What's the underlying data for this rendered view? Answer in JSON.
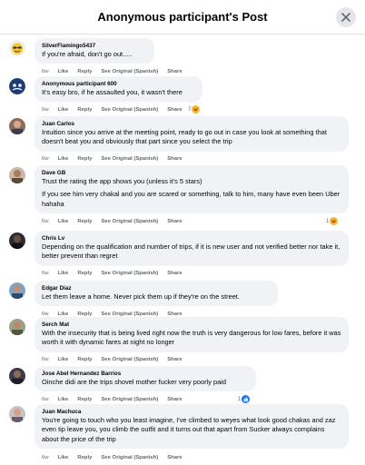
{
  "header": {
    "title": "Anonymous participant's Post"
  },
  "actions": {
    "like": "Like",
    "reply": "Reply",
    "see_original": "See Original (Spanish)",
    "share": "Share"
  },
  "comments": [
    {
      "author": "SilverFlamingo5437",
      "paragraphs": [
        "If you're afraid, don't go out....."
      ],
      "time": "6w",
      "reactions": null,
      "avatar": "emoji"
    },
    {
      "author": "Anonymous participant 600",
      "paragraphs": [
        "It's easy bro, if he assaulted you, it wasn't there"
      ],
      "time": "6w",
      "reactions": "7",
      "avatar": "anon"
    },
    {
      "author": "Juan Carlos",
      "paragraphs": [
        "Intuition since you arrive at the meeting point, ready to go out in case you look at something that doesn't beat you and obviously that part since you select the trip"
      ],
      "time": "6w",
      "reactions": null,
      "avatar": "photo"
    },
    {
      "author": "Dave GB",
      "paragraphs": [
        "Trust the rating the app shows you (unless it's 5 stars)",
        "If you see him very chakal and you are scared or something, talk to him, many have even been Uber hahaha"
      ],
      "time": "6w",
      "reactions": "1",
      "avatar": "photo"
    },
    {
      "author": "Chris Lv",
      "paragraphs": [
        "Depending on the qualification and number of trips, if it is new user and not verified better nor take it, better prevent than regret"
      ],
      "time": "6w",
      "reactions": null,
      "avatar": "photo"
    },
    {
      "author": "Edgar Diaz",
      "paragraphs": [
        "Let them leave a home. Never pick them up if they're on the street."
      ],
      "time": "6w",
      "reactions": null,
      "avatar": "photo"
    },
    {
      "author": "Serch Mat",
      "paragraphs": [
        "With the insecurity that is being lived right now the truth is very dangerous for low fares, before it was worth it with dynamic fares at night no longer"
      ],
      "time": "6w",
      "reactions": null,
      "avatar": "photo"
    },
    {
      "author": "Jose Abel Hernandez Barrios",
      "paragraphs": [
        "Oinche didi are the trips shovel mother fucker very poorly paid"
      ],
      "time": "6w",
      "reactions": "1",
      "avatar": "photo"
    },
    {
      "author": "Juan Machuca",
      "paragraphs": [
        "You're going to touch who you least imagine, I've climbed to weyes what look good chakas and zaz even tip leave you, you climb the outfit and it turns out that apart from Sucker always complains about the price of the trip"
      ],
      "time": "6w",
      "reactions": null,
      "avatar": "photo"
    }
  ]
}
